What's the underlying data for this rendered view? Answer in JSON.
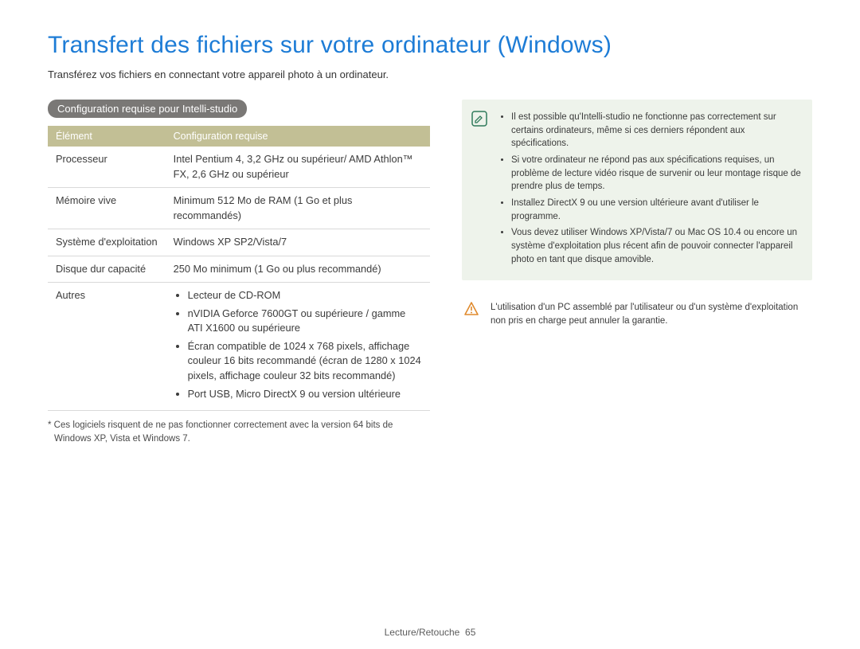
{
  "title": "Transfert des fichiers sur votre ordinateur (Windows)",
  "intro": "Transférez vos fichiers en connectant votre appareil photo à un ordinateur.",
  "section_label": "Configuration requise pour Intelli-studio",
  "table": {
    "head_item": "Élément",
    "head_req": "Configuration requise",
    "rows": {
      "cpu_label": "Processeur",
      "cpu_val": "Intel Pentium 4, 3,2 GHz ou supérieur/ AMD Athlon™ FX, 2,6 GHz ou supérieur",
      "ram_label": "Mémoire vive",
      "ram_val": "Minimum 512 Mo de RAM (1 Go et plus recommandés)",
      "os_label": "Système d'exploitation",
      "os_val": "Windows XP SP2/Vista/7",
      "disk_label": "Disque dur capacité",
      "disk_val": "250 Mo minimum (1 Go ou plus recommandé)",
      "other_label": "Autres",
      "other_1": "Lecteur de CD-ROM",
      "other_2": "nVIDIA Geforce 7600GT ou supérieure / gamme ATI X1600 ou supérieure",
      "other_3": "Écran compatible de 1024 x 768 pixels, affichage couleur 16 bits recommandé (écran de 1280 x 1024 pixels, affichage couleur 32 bits recommandé)",
      "other_4": "Port USB, Micro DirectX 9 ou version ultérieure"
    }
  },
  "footnote": "* Ces logiciels risquent de ne pas fonctionner correctement avec la version 64 bits de Windows XP, Vista et Windows 7.",
  "note": {
    "items": {
      "n1": "Il est possible qu'Intelli-studio ne fonctionne pas correctement sur certains ordinateurs, même si ces derniers répondent aux spécifications.",
      "n2": "Si votre ordinateur ne répond pas aux spécifications requises, un problème de lecture vidéo risque de survenir ou leur montage risque de prendre plus de temps.",
      "n3": "Installez DirectX 9 ou une version ultérieure avant d'utiliser le programme.",
      "n4": "Vous devez utiliser Windows XP/Vista/7 ou Mac OS 10.4 ou encore un système d'exploitation plus récent afin de pouvoir connecter l'appareil photo en tant que disque amovible."
    }
  },
  "warning": "L'utilisation d'un PC assemblé par l'utilisateur ou d'un système d'exploitation non pris en charge peut annuler la garantie.",
  "footer_section": "Lecture/Retouche",
  "footer_page": "65",
  "icons": {
    "note": "note-pencil-icon",
    "warn": "warning-triangle-icon"
  },
  "colors": {
    "title_blue": "#1d7cd6",
    "table_head_bg": "#c2bf95",
    "pill_bg": "#7a7876",
    "note_bg": "#eef3eb",
    "warn_stroke": "#e08a2d"
  }
}
